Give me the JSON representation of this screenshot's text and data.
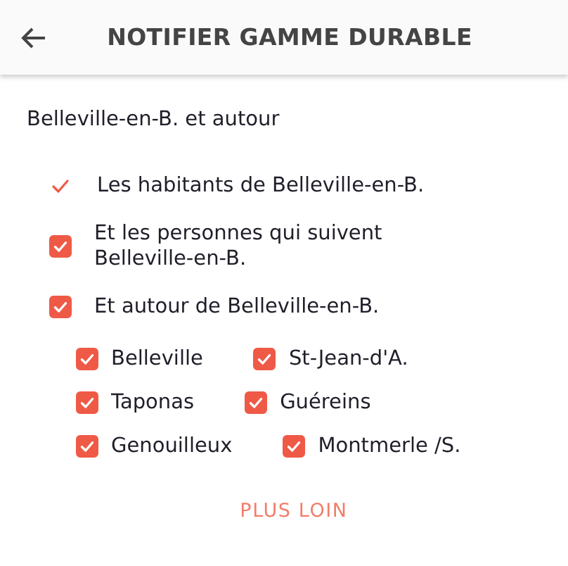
{
  "header": {
    "title": "NOTIFIER GAMME DURABLE"
  },
  "section": {
    "title": "Belleville-en-B. et autour"
  },
  "options": [
    {
      "kind": "tick",
      "label": "Les habitants de Belleville-en-B.",
      "checked": true
    },
    {
      "kind": "checkbox",
      "label": "Et les personnes qui suivent Belleville-en-B.",
      "checked": true
    },
    {
      "kind": "checkbox",
      "label": "Et autour de Belleville-en-B.",
      "checked": true
    }
  ],
  "town_rows": [
    [
      {
        "label": "Belleville",
        "checked": true
      },
      {
        "label": "St-Jean-d'A.",
        "checked": true
      }
    ],
    [
      {
        "label": "Taponas",
        "checked": true
      },
      {
        "label": "Guéreins",
        "checked": true
      }
    ],
    [
      {
        "label": "Genouilleux",
        "checked": true
      },
      {
        "label": "Montmerle /S.",
        "checked": true
      }
    ]
  ],
  "button": {
    "label": "PLUS LOIN"
  }
}
